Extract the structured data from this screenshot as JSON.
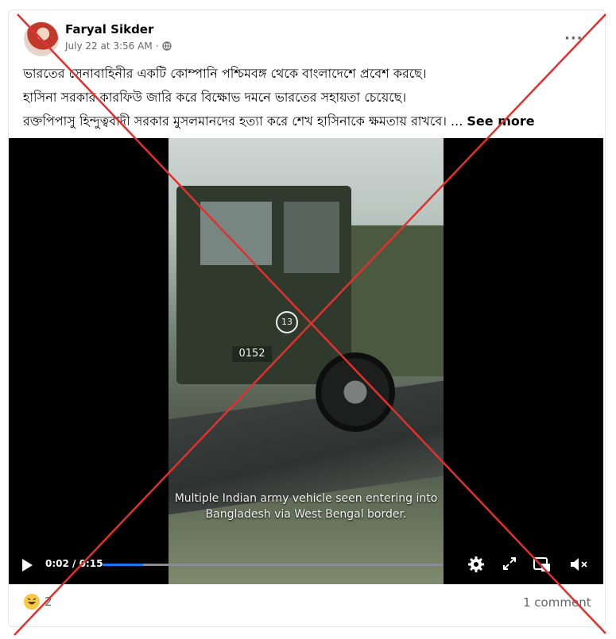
{
  "post": {
    "author": "Faryal Sikder",
    "timestamp": "July 22 at 3:56 AM",
    "separator": "·",
    "more_label": "···",
    "lines": [
      "ভারতের সেনাবাহিনীর একটি কোম্পানি পশ্চিমবঙ্গ থেকে বাংলাদেশে প্রবেশ করছে।",
      "হাসিনা সরকার কারফিউ জারি করে বিক্ষোভ দমনে ভারতের সহায়তা চেয়েছে।",
      "রক্তপিপাসু হিন্দুত্ববাদী সরকার মুসলমানদের হত্যা করে শেখ হাসিনাকে ক্ষমতায় রাখবে। ..."
    ],
    "see_more": "See more"
  },
  "video": {
    "caption_line1": "Multiple Indian army vehicle seen entering into",
    "caption_line2": "Bangladesh via West Bengal border.",
    "plate_text": "0152",
    "badge_text": "13",
    "current_time": "0:02",
    "duration": "0:15",
    "time_separator": " / ",
    "progress_fraction": 0.12
  },
  "footer": {
    "reaction_count": "2",
    "comment_count": "1 comment"
  },
  "colors": {
    "accent": "#1877f2",
    "cross": "#e0312f"
  },
  "icons": [
    "globe-icon",
    "more-icon",
    "play-icon",
    "settings-icon",
    "fullscreen-icon",
    "pip-icon",
    "volume-icon",
    "haha-reaction-icon"
  ]
}
